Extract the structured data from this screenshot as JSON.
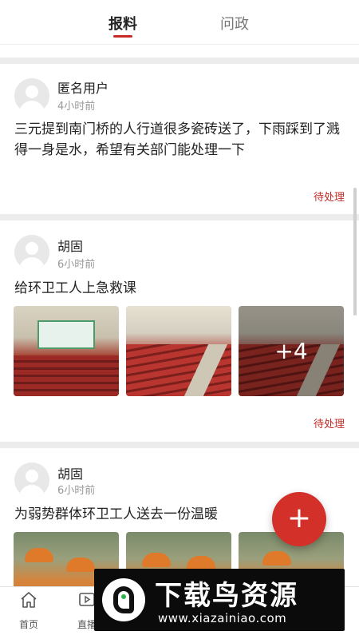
{
  "tabs": [
    {
      "label": "报料",
      "active": true
    },
    {
      "label": "问政",
      "active": false
    }
  ],
  "posts": [
    {
      "user": "匿名用户",
      "time": "4小时前",
      "text": "三元提到南门桥的人行道很多瓷砖送了，下雨踩到了溅得一身是水，希望有关部门能处理一下",
      "status": "待处理"
    },
    {
      "user": "胡固",
      "time": "6小时前",
      "text": "给环卫工人上急救课",
      "status": "待处理",
      "more_photos": "+4"
    },
    {
      "user": "胡固",
      "time": "6小时前",
      "text": "为弱势群体环卫工人送去一份温暖"
    }
  ],
  "fab": {
    "icon": "plus-icon",
    "symbol": "+"
  },
  "bottom_nav": [
    {
      "label": "首页",
      "icon": "home-icon"
    },
    {
      "label": "直播",
      "icon": "live-icon"
    }
  ],
  "watermark": {
    "title": "下载鸟资源",
    "url": "www.xiazainiao.com"
  },
  "colors": {
    "accent": "#c42b26",
    "fab": "#d3302a",
    "separator": "#ececec"
  }
}
